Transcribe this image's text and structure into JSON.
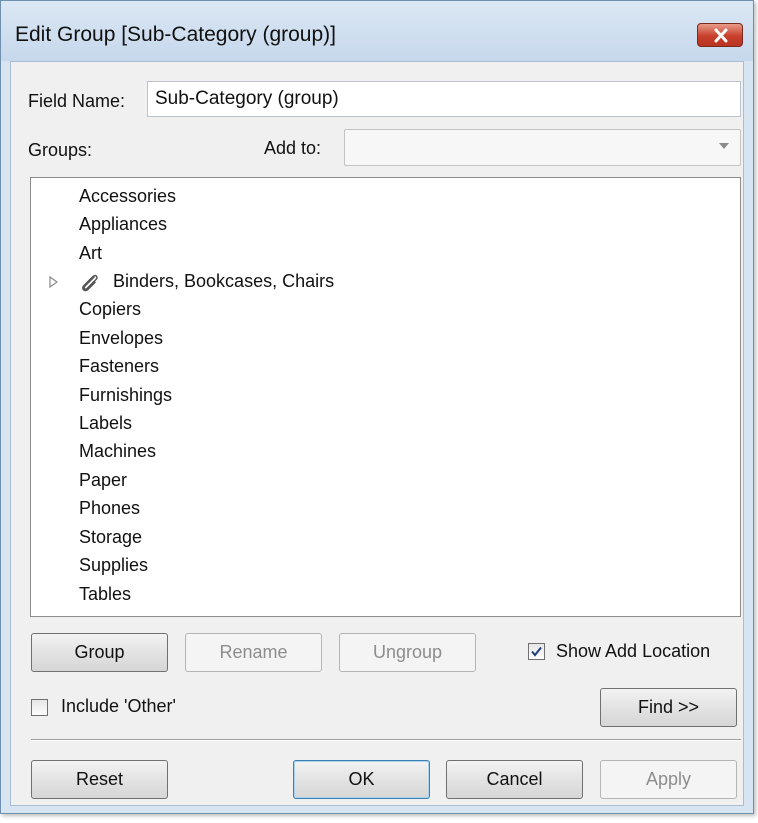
{
  "window": {
    "title": "Edit Group [Sub-Category (group)]",
    "close_icon": "close-icon"
  },
  "field_name": {
    "label": "Field Name:",
    "value": "Sub-Category (group)"
  },
  "groups": {
    "label": "Groups:",
    "add_to_label": "Add to:",
    "add_to_value": "",
    "items": [
      "Accessories",
      "Appliances",
      "Art",
      "Binders, Bookcases, Chairs",
      "Copiers",
      "Envelopes",
      "Fasteners",
      "Furnishings",
      "Labels",
      "Machines",
      "Paper",
      "Phones",
      "Storage",
      "Supplies",
      "Tables"
    ]
  },
  "buttons": {
    "group": "Group",
    "rename": "Rename",
    "ungroup": "Ungroup",
    "find": "Find >>",
    "reset": "Reset",
    "ok": "OK",
    "cancel": "Cancel",
    "apply": "Apply"
  },
  "options": {
    "show_add_location_label": "Show Add Location",
    "show_add_location_checked": true,
    "include_other_label": "Include 'Other'",
    "include_other_checked": false
  },
  "colors": {
    "title_bar": "#c6d8ec",
    "close_button": "#c7402c",
    "dialog_background": "#f0f0f0",
    "default_button_border": "#3c7fb1"
  }
}
